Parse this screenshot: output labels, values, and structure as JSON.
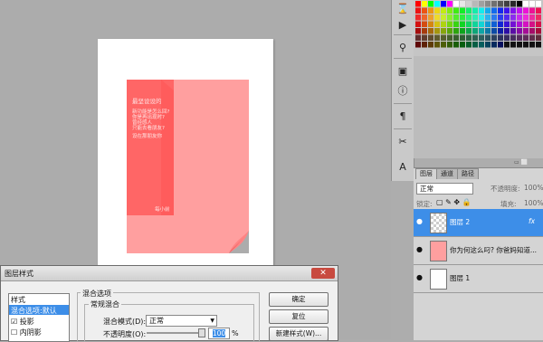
{
  "cover": {
    "title": "最坚设设的",
    "lines": [
      "新功能是怎么回?",
      "你是再出现时?",
      "曾经感人",
      "只能去看朋友?"
    ],
    "caption": "设在那朋友你",
    "author": "每小前"
  },
  "layers_panel": {
    "tabs": [
      "图层",
      "通道",
      "路径"
    ],
    "blend_mode": "正常",
    "opacity_label": "不透明度:",
    "opacity_value": "100%",
    "lock_label": "锁定:",
    "fill_label": "填充:",
    "fill_value": "100%",
    "layers": [
      {
        "name": "图层 2",
        "fx": "fx"
      },
      {
        "name": "你为何这么叼? 你爸妈知道..."
      },
      {
        "name": "图层 1"
      }
    ]
  },
  "dialog": {
    "title": "图层样式",
    "close": "✕",
    "styles_header": "样式",
    "styles": [
      "混合选项:默认",
      "投影",
      "内阴影"
    ],
    "section_title": "混合选项",
    "subsection_title": "常规混合",
    "blend_mode_label": "混合模式(D):",
    "blend_mode_value": "正常",
    "opacity_label": "不透明度(O):",
    "opacity_value": "100",
    "opacity_unit": "%",
    "buttons": [
      "确定",
      "复位",
      "新建样式(W)..."
    ]
  },
  "colors": {
    "cover_light": "#ff9f9f",
    "cover_dark": "#ff6666",
    "selected_layer": "#3d8ee8",
    "close_button": "#c84a3f"
  }
}
